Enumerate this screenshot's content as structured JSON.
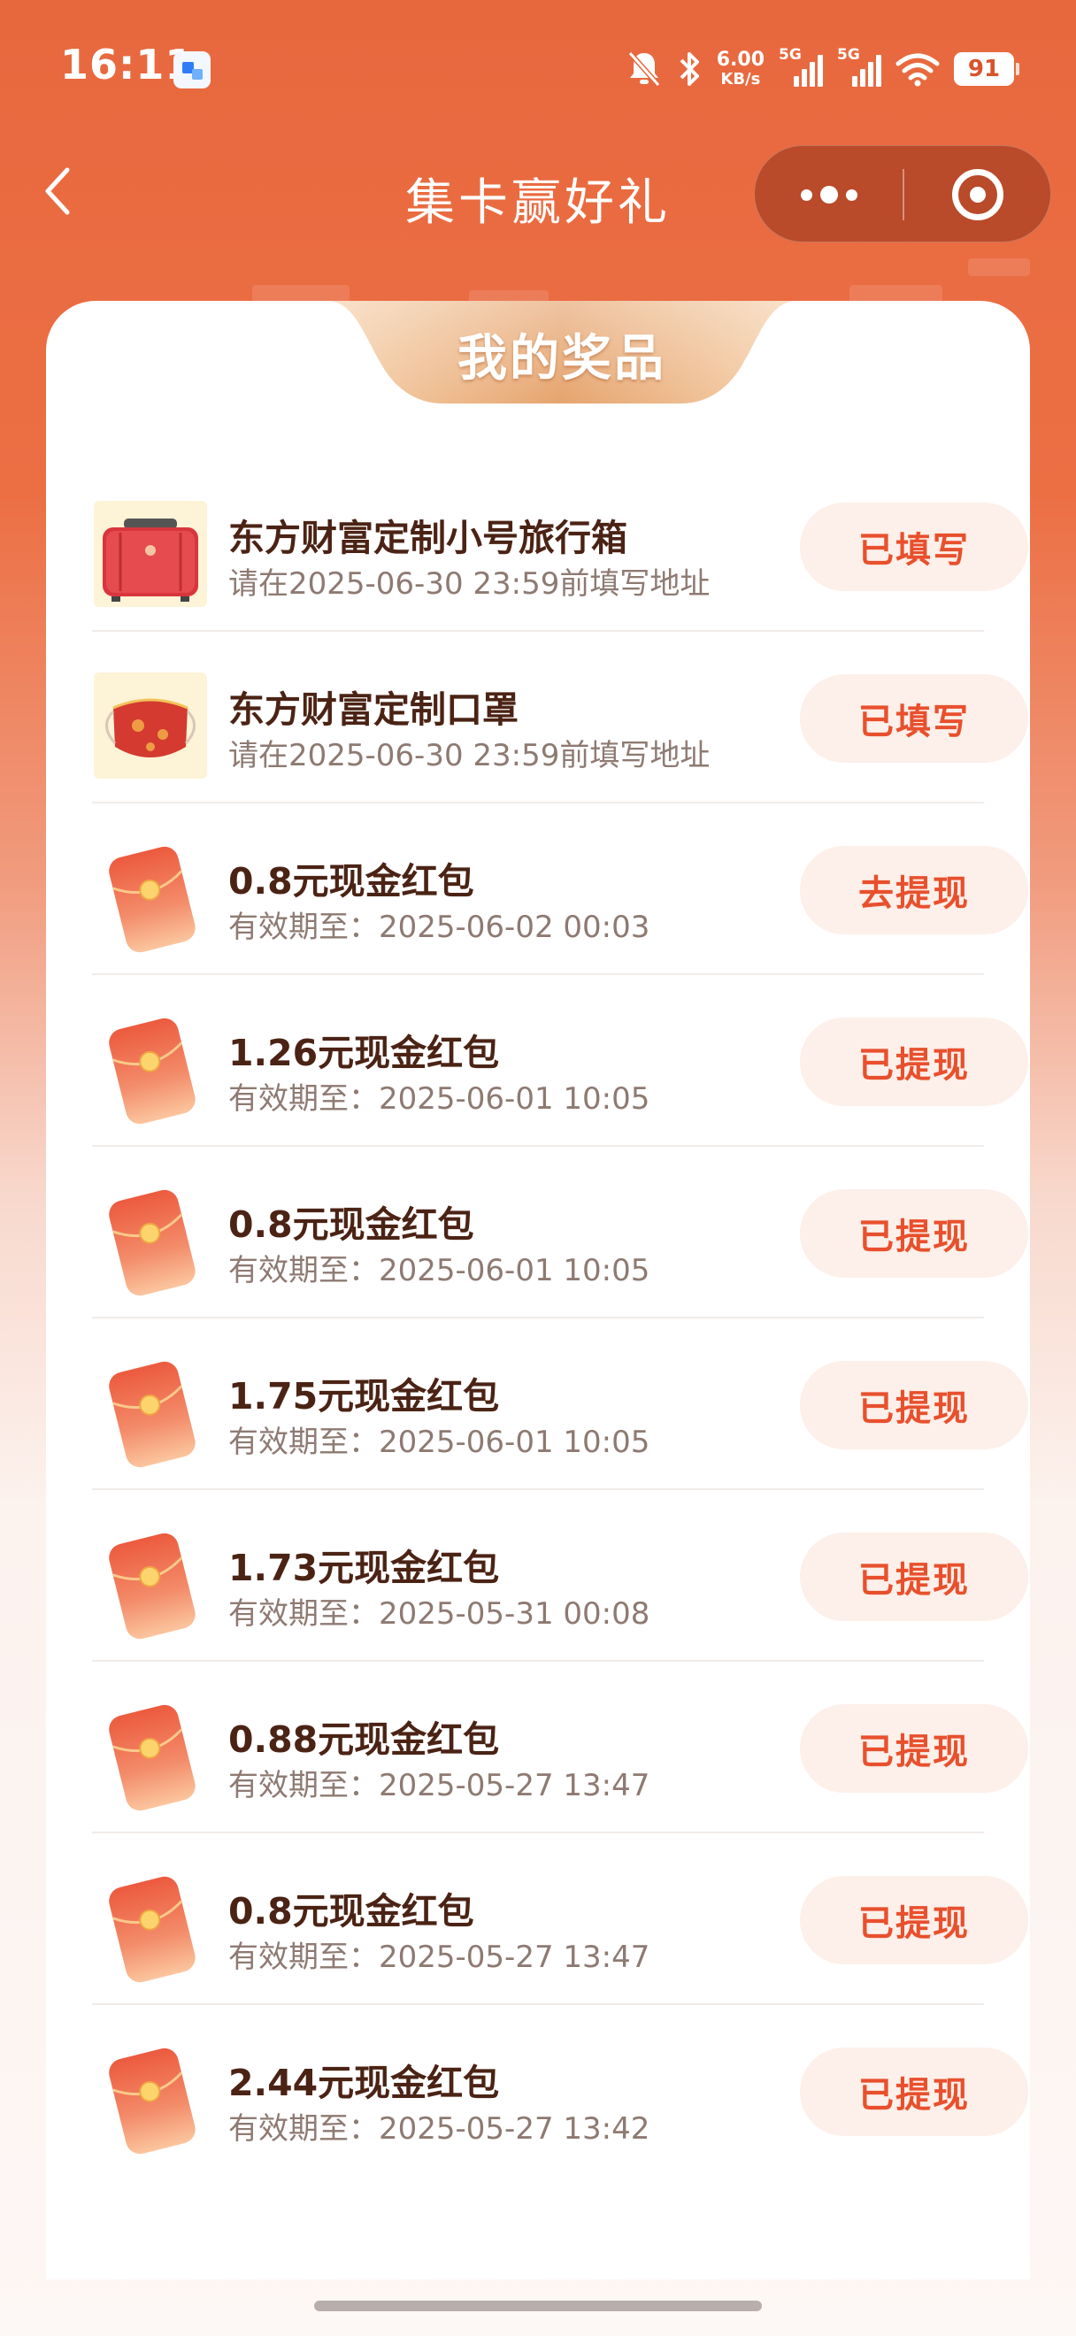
{
  "status_bar": {
    "time": "16:11",
    "speed_value": "6.00",
    "speed_unit": "KB/s",
    "signal1_label": "5G",
    "signal2_label": "5G",
    "battery": "91",
    "icons": [
      "app-notification-icon",
      "mute-bell-icon",
      "bluetooth-icon",
      "signal-icon",
      "wifi-icon",
      "battery-icon"
    ]
  },
  "nav": {
    "title": "集卡赢好礼",
    "back_icon": "chevron-left-icon",
    "more_icon": "more-dots-icon",
    "close_icon": "target-close-icon"
  },
  "card": {
    "title": "我的奖品"
  },
  "prizes": [
    {
      "type": "suitcase",
      "title": "东方财富定制小号旅行箱",
      "subtitle": "请在2025-06-30 23:59前填写地址",
      "action": "已填写"
    },
    {
      "type": "mask",
      "title": "东方财富定制口罩",
      "subtitle": "请在2025-06-30 23:59前填写地址",
      "action": "已填写"
    },
    {
      "type": "red-envelope",
      "title": "0.8元现金红包",
      "subtitle": "有效期至：2025-06-02 00:03",
      "action": "去提现"
    },
    {
      "type": "red-envelope",
      "title": "1.26元现金红包",
      "subtitle": "有效期至：2025-06-01 10:05",
      "action": "已提现"
    },
    {
      "type": "red-envelope",
      "title": "0.8元现金红包",
      "subtitle": "有效期至：2025-06-01 10:05",
      "action": "已提现"
    },
    {
      "type": "red-envelope",
      "title": "1.75元现金红包",
      "subtitle": "有效期至：2025-06-01 10:05",
      "action": "已提现"
    },
    {
      "type": "red-envelope",
      "title": "1.73元现金红包",
      "subtitle": "有效期至：2025-05-31 00:08",
      "action": "已提现"
    },
    {
      "type": "red-envelope",
      "title": "0.88元现金红包",
      "subtitle": "有效期至：2025-05-27 13:47",
      "action": "已提现"
    },
    {
      "type": "red-envelope",
      "title": "0.8元现金红包",
      "subtitle": "有效期至：2025-05-27 13:47",
      "action": "已提现"
    },
    {
      "type": "red-envelope",
      "title": "2.44元现金红包",
      "subtitle": "有效期至：2025-05-27 13:42",
      "action": "已提现"
    }
  ],
  "colors": {
    "accent": "#e8502d",
    "header_bg": "#e8683e",
    "button_bg": "#fdefe9",
    "title_text": "#4b2315",
    "sub_text": "#8e7a72"
  }
}
